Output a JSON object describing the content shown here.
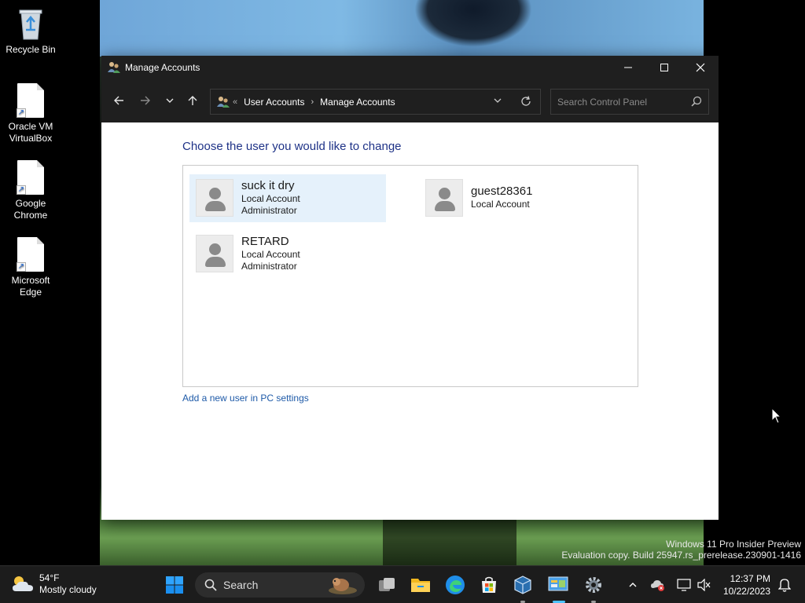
{
  "desktop": {
    "icons": [
      {
        "label": "Recycle Bin"
      },
      {
        "label": "Oracle VM VirtualBox"
      },
      {
        "label": "Google Chrome"
      },
      {
        "label": "Microsoft Edge"
      }
    ]
  },
  "window": {
    "title": "Manage Accounts",
    "controls": {
      "minimize": "—",
      "maximize": "☐",
      "close": "✕"
    },
    "address": {
      "overflow": "«",
      "crumbs": [
        "User Accounts",
        "Manage Accounts"
      ],
      "separator": "›"
    },
    "search": {
      "placeholder": "Search Control Panel"
    },
    "heading": "Choose the user you would like to change",
    "accounts": [
      {
        "name": "suck it dry",
        "type": "Local Account",
        "role": "Administrator",
        "selected": true
      },
      {
        "name": "guest28361",
        "type": "Local Account",
        "role": ""
      },
      {
        "name": "RETARD",
        "type": "Local Account",
        "role": "Administrator"
      }
    ],
    "add_user_link": "Add a new user in PC settings"
  },
  "watermark": {
    "line1": "Windows 11 Pro Insider Preview",
    "line2": "Evaluation copy. Build 25947.rs_prerelease.230901-1416"
  },
  "taskbar": {
    "weather": {
      "temp": "54°F",
      "condition": "Mostly cloudy"
    },
    "search_label": "Search",
    "clock": {
      "time": "12:37 PM",
      "date": "10/22/2023"
    }
  },
  "colors": {
    "accent": "#0067c0",
    "heading": "#1e3287",
    "link": "#1e5aa8",
    "selection": "#e5f1fb",
    "titlebar": "#1f1f1f",
    "taskbar": "#1c1c1c"
  }
}
